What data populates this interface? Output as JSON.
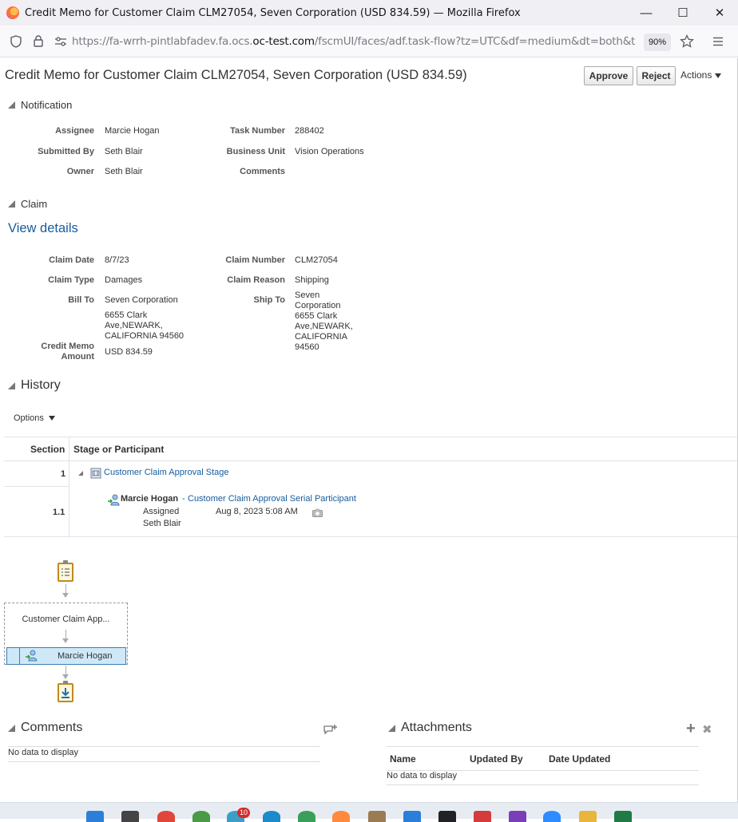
{
  "browser": {
    "window_title": "Credit Memo for Customer Claim CLM27054, Seven Corporation (USD 834.59) — Mozilla Firefox",
    "url_prefix": "https://fa-wrrh-pintlabfadev.fa.ocs.",
    "url_domain": "oc-test.com",
    "url_suffix": "/fscmUI/faces/adf.task-flow?tz=UTC&df=medium&dt=both&tf=shor",
    "zoom": "90%",
    "minimize": "—",
    "maximize": "☐",
    "close": "✕"
  },
  "page": {
    "title": "Credit Memo for Customer Claim CLM27054, Seven Corporation (USD 834.59)",
    "approve_label": "Approve",
    "reject_label": "Reject",
    "actions_label": "Actions"
  },
  "notification": {
    "heading": "Notification",
    "assignee_label": "Assignee",
    "assignee": "Marcie Hogan",
    "submitted_by_label": "Submitted By",
    "submitted_by": "Seth Blair",
    "owner_label": "Owner",
    "owner": "Seth Blair",
    "task_number_label": "Task Number",
    "task_number": "288402",
    "business_unit_label": "Business Unit",
    "business_unit": "Vision Operations",
    "comments_label": "Comments"
  },
  "claim": {
    "heading": "Claim",
    "view_details": "View details",
    "claim_date_label": "Claim Date",
    "claim_date": "8/7/23",
    "claim_type_label": "Claim Type",
    "claim_type": "Damages",
    "bill_to_label": "Bill To",
    "bill_to_line1": "Seven Corporation",
    "bill_to_line2": "6655 Clark",
    "bill_to_line3": "Ave,NEWARK,",
    "bill_to_line4": "CALIFORNIA 94560",
    "credit_memo_label_line1": "Credit Memo",
    "credit_memo_label_line2": "Amount",
    "credit_memo_amount": "USD 834.59",
    "claim_number_label": "Claim Number",
    "claim_number": "CLM27054",
    "claim_reason_label": "Claim Reason",
    "claim_reason": "Shipping",
    "ship_to_label": "Ship To",
    "ship_to_line1": "Seven",
    "ship_to_line2": "Corporation",
    "ship_to_line3": "6655 Clark",
    "ship_to_line4": "Ave,NEWARK,",
    "ship_to_line5": "CALIFORNIA",
    "ship_to_line6": "94560"
  },
  "history": {
    "heading": "History",
    "options_label": "Options",
    "col_section": "Section",
    "col_stage": "Stage or Participant",
    "rows": [
      {
        "section": "1",
        "stage": "Customer Claim Approval Stage"
      },
      {
        "section": "1.1",
        "participant": "Marcie Hogan",
        "separator": " - ",
        "role": "Customer Claim Approval Serial Participant",
        "action": "Assigned",
        "timestamp": "Aug 8, 2023 5:08 AM",
        "by": "Seth Blair"
      }
    ]
  },
  "diagram": {
    "stage_label": "Customer Claim App...",
    "participant_label": "Marcie Hogan"
  },
  "comments": {
    "heading": "Comments",
    "empty": "No data to display"
  },
  "attachments": {
    "heading": "Attachments",
    "col_name": "Name",
    "col_updated_by": "Updated By",
    "col_date_updated": "Date Updated",
    "empty": "No data to display",
    "add": "+",
    "remove": "✖"
  },
  "taskbar": {
    "badge": "10"
  },
  "colors": {
    "link": "#145c9e",
    "participant_fill": "#cfe8f8",
    "participant_border": "#3d7cb5"
  }
}
